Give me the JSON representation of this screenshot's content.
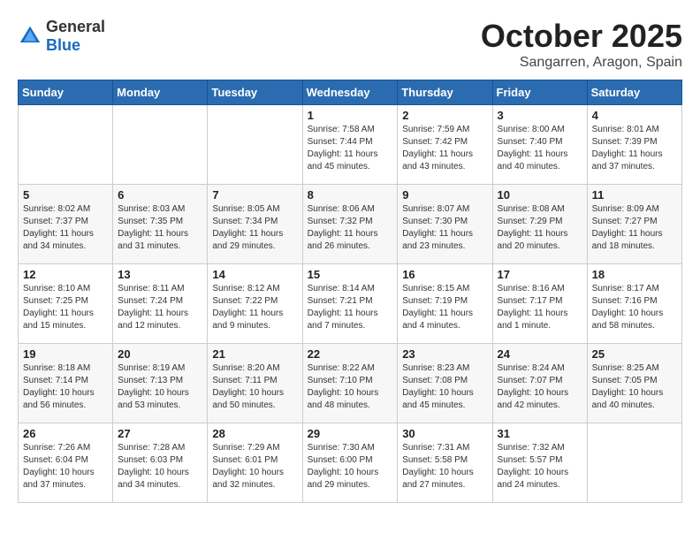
{
  "header": {
    "logo_general": "General",
    "logo_blue": "Blue",
    "month": "October 2025",
    "location": "Sangarren, Aragon, Spain"
  },
  "weekdays": [
    "Sunday",
    "Monday",
    "Tuesday",
    "Wednesday",
    "Thursday",
    "Friday",
    "Saturday"
  ],
  "weeks": [
    [
      {
        "day": "",
        "sunrise": "",
        "sunset": "",
        "daylight": ""
      },
      {
        "day": "",
        "sunrise": "",
        "sunset": "",
        "daylight": ""
      },
      {
        "day": "",
        "sunrise": "",
        "sunset": "",
        "daylight": ""
      },
      {
        "day": "1",
        "sunrise": "Sunrise: 7:58 AM",
        "sunset": "Sunset: 7:44 PM",
        "daylight": "Daylight: 11 hours and 45 minutes."
      },
      {
        "day": "2",
        "sunrise": "Sunrise: 7:59 AM",
        "sunset": "Sunset: 7:42 PM",
        "daylight": "Daylight: 11 hours and 43 minutes."
      },
      {
        "day": "3",
        "sunrise": "Sunrise: 8:00 AM",
        "sunset": "Sunset: 7:40 PM",
        "daylight": "Daylight: 11 hours and 40 minutes."
      },
      {
        "day": "4",
        "sunrise": "Sunrise: 8:01 AM",
        "sunset": "Sunset: 7:39 PM",
        "daylight": "Daylight: 11 hours and 37 minutes."
      }
    ],
    [
      {
        "day": "5",
        "sunrise": "Sunrise: 8:02 AM",
        "sunset": "Sunset: 7:37 PM",
        "daylight": "Daylight: 11 hours and 34 minutes."
      },
      {
        "day": "6",
        "sunrise": "Sunrise: 8:03 AM",
        "sunset": "Sunset: 7:35 PM",
        "daylight": "Daylight: 11 hours and 31 minutes."
      },
      {
        "day": "7",
        "sunrise": "Sunrise: 8:05 AM",
        "sunset": "Sunset: 7:34 PM",
        "daylight": "Daylight: 11 hours and 29 minutes."
      },
      {
        "day": "8",
        "sunrise": "Sunrise: 8:06 AM",
        "sunset": "Sunset: 7:32 PM",
        "daylight": "Daylight: 11 hours and 26 minutes."
      },
      {
        "day": "9",
        "sunrise": "Sunrise: 8:07 AM",
        "sunset": "Sunset: 7:30 PM",
        "daylight": "Daylight: 11 hours and 23 minutes."
      },
      {
        "day": "10",
        "sunrise": "Sunrise: 8:08 AM",
        "sunset": "Sunset: 7:29 PM",
        "daylight": "Daylight: 11 hours and 20 minutes."
      },
      {
        "day": "11",
        "sunrise": "Sunrise: 8:09 AM",
        "sunset": "Sunset: 7:27 PM",
        "daylight": "Daylight: 11 hours and 18 minutes."
      }
    ],
    [
      {
        "day": "12",
        "sunrise": "Sunrise: 8:10 AM",
        "sunset": "Sunset: 7:25 PM",
        "daylight": "Daylight: 11 hours and 15 minutes."
      },
      {
        "day": "13",
        "sunrise": "Sunrise: 8:11 AM",
        "sunset": "Sunset: 7:24 PM",
        "daylight": "Daylight: 11 hours and 12 minutes."
      },
      {
        "day": "14",
        "sunrise": "Sunrise: 8:12 AM",
        "sunset": "Sunset: 7:22 PM",
        "daylight": "Daylight: 11 hours and 9 minutes."
      },
      {
        "day": "15",
        "sunrise": "Sunrise: 8:14 AM",
        "sunset": "Sunset: 7:21 PM",
        "daylight": "Daylight: 11 hours and 7 minutes."
      },
      {
        "day": "16",
        "sunrise": "Sunrise: 8:15 AM",
        "sunset": "Sunset: 7:19 PM",
        "daylight": "Daylight: 11 hours and 4 minutes."
      },
      {
        "day": "17",
        "sunrise": "Sunrise: 8:16 AM",
        "sunset": "Sunset: 7:17 PM",
        "daylight": "Daylight: 11 hours and 1 minute."
      },
      {
        "day": "18",
        "sunrise": "Sunrise: 8:17 AM",
        "sunset": "Sunset: 7:16 PM",
        "daylight": "Daylight: 10 hours and 58 minutes."
      }
    ],
    [
      {
        "day": "19",
        "sunrise": "Sunrise: 8:18 AM",
        "sunset": "Sunset: 7:14 PM",
        "daylight": "Daylight: 10 hours and 56 minutes."
      },
      {
        "day": "20",
        "sunrise": "Sunrise: 8:19 AM",
        "sunset": "Sunset: 7:13 PM",
        "daylight": "Daylight: 10 hours and 53 minutes."
      },
      {
        "day": "21",
        "sunrise": "Sunrise: 8:20 AM",
        "sunset": "Sunset: 7:11 PM",
        "daylight": "Daylight: 10 hours and 50 minutes."
      },
      {
        "day": "22",
        "sunrise": "Sunrise: 8:22 AM",
        "sunset": "Sunset: 7:10 PM",
        "daylight": "Daylight: 10 hours and 48 minutes."
      },
      {
        "day": "23",
        "sunrise": "Sunrise: 8:23 AM",
        "sunset": "Sunset: 7:08 PM",
        "daylight": "Daylight: 10 hours and 45 minutes."
      },
      {
        "day": "24",
        "sunrise": "Sunrise: 8:24 AM",
        "sunset": "Sunset: 7:07 PM",
        "daylight": "Daylight: 10 hours and 42 minutes."
      },
      {
        "day": "25",
        "sunrise": "Sunrise: 8:25 AM",
        "sunset": "Sunset: 7:05 PM",
        "daylight": "Daylight: 10 hours and 40 minutes."
      }
    ],
    [
      {
        "day": "26",
        "sunrise": "Sunrise: 7:26 AM",
        "sunset": "Sunset: 6:04 PM",
        "daylight": "Daylight: 10 hours and 37 minutes."
      },
      {
        "day": "27",
        "sunrise": "Sunrise: 7:28 AM",
        "sunset": "Sunset: 6:03 PM",
        "daylight": "Daylight: 10 hours and 34 minutes."
      },
      {
        "day": "28",
        "sunrise": "Sunrise: 7:29 AM",
        "sunset": "Sunset: 6:01 PM",
        "daylight": "Daylight: 10 hours and 32 minutes."
      },
      {
        "day": "29",
        "sunrise": "Sunrise: 7:30 AM",
        "sunset": "Sunset: 6:00 PM",
        "daylight": "Daylight: 10 hours and 29 minutes."
      },
      {
        "day": "30",
        "sunrise": "Sunrise: 7:31 AM",
        "sunset": "Sunset: 5:58 PM",
        "daylight": "Daylight: 10 hours and 27 minutes."
      },
      {
        "day": "31",
        "sunrise": "Sunrise: 7:32 AM",
        "sunset": "Sunset: 5:57 PM",
        "daylight": "Daylight: 10 hours and 24 minutes."
      },
      {
        "day": "",
        "sunrise": "",
        "sunset": "",
        "daylight": ""
      }
    ]
  ]
}
